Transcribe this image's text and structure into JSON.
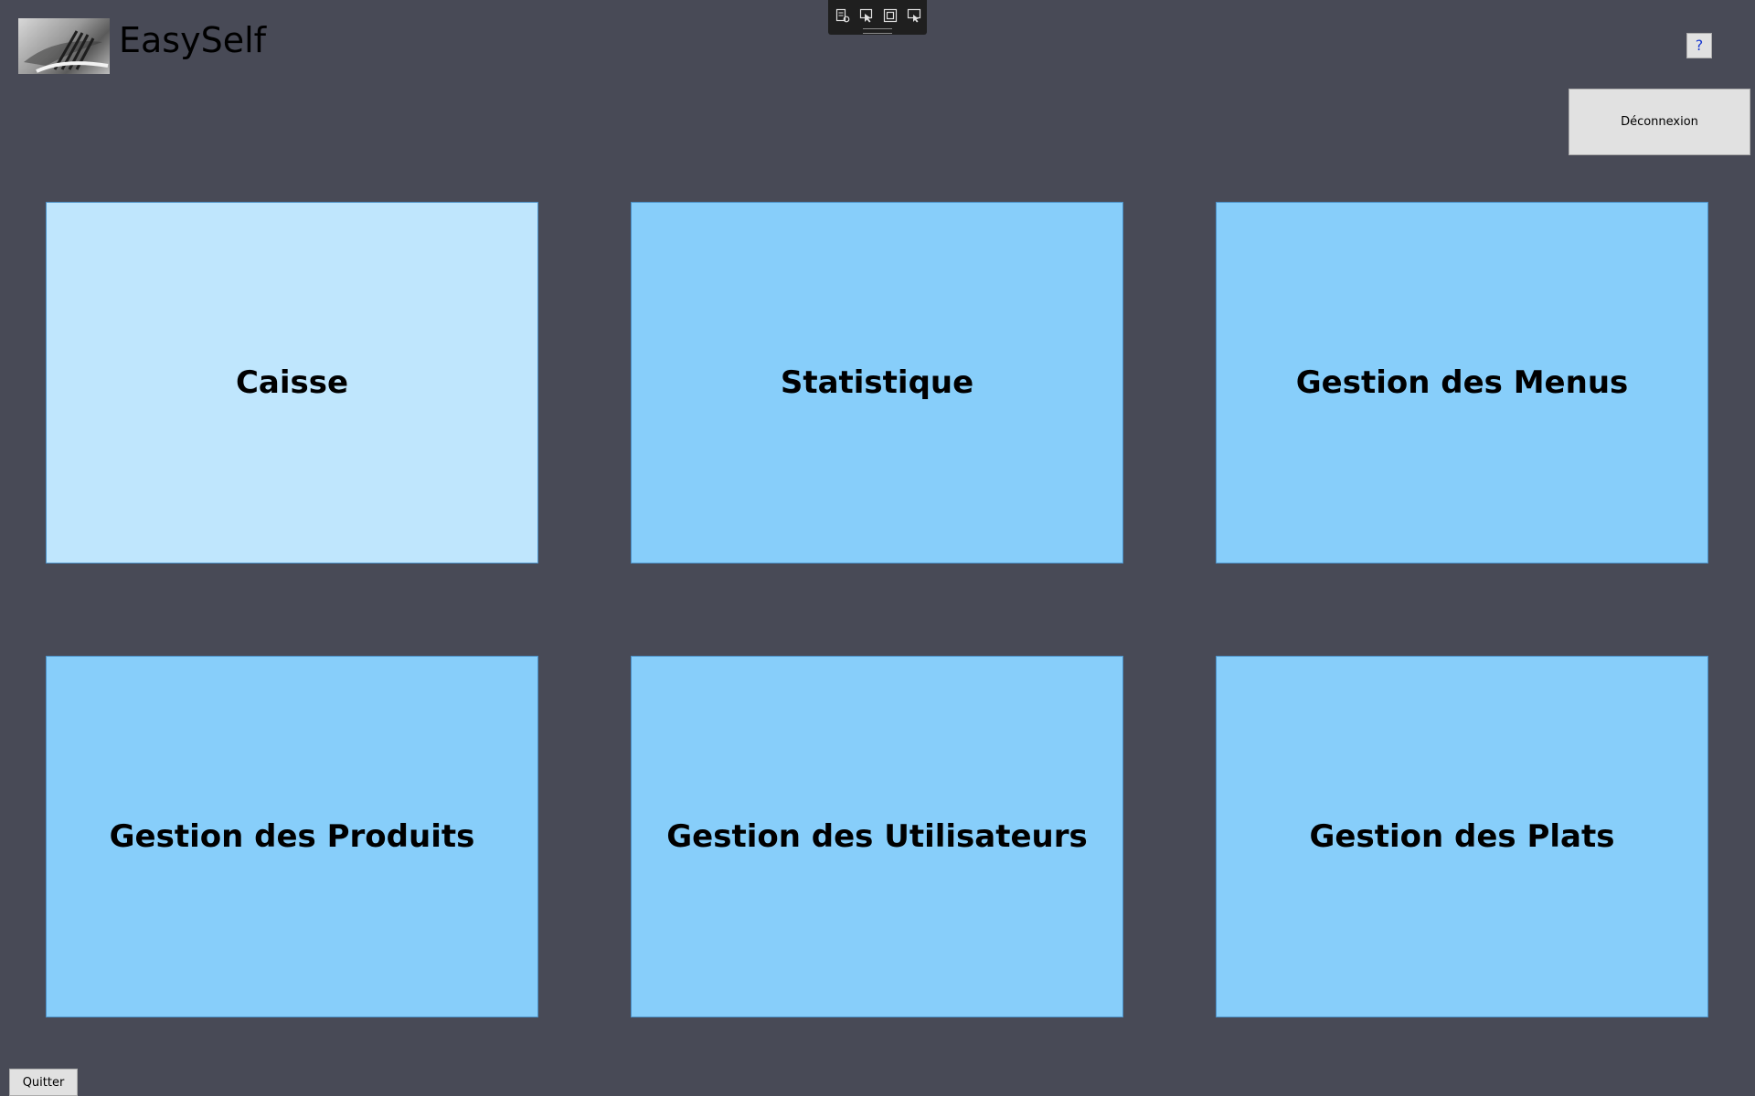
{
  "header": {
    "app_title": "EasySelf",
    "logo_icon": "fork-knife-logo-icon"
  },
  "debug_toolbar": {
    "icons": [
      "live-visual-tree-icon",
      "select-element-icon",
      "display-layout-adorners-icon",
      "track-focus-icon"
    ]
  },
  "help_button": {
    "label": "?"
  },
  "logout_button": {
    "label": "Déconnexion"
  },
  "tiles": [
    {
      "label": "Caisse"
    },
    {
      "label": "Statistique"
    },
    {
      "label": "Gestion des Menus"
    },
    {
      "label": "Gestion des Produits"
    },
    {
      "label": "Gestion des Utilisateurs"
    },
    {
      "label": "Gestion des Plats"
    }
  ],
  "quit_button": {
    "label": "Quitter"
  },
  "colors": {
    "background": "#484a56",
    "tile": "#87cefa",
    "tile_hover": "#bfe6fd",
    "button": "#e1e1e1"
  }
}
